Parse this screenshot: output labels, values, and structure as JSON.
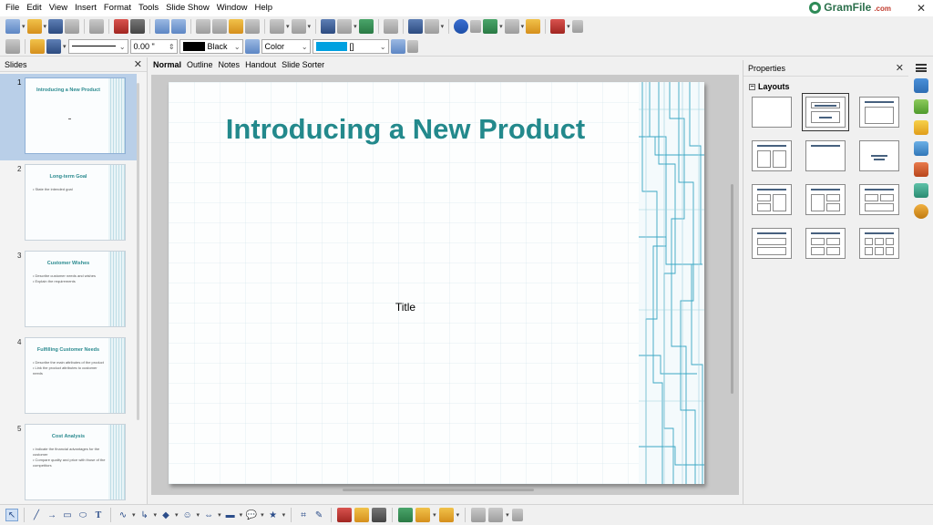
{
  "menu": [
    "File",
    "Edit",
    "View",
    "Insert",
    "Format",
    "Tools",
    "Slide Show",
    "Window",
    "Help"
  ],
  "brand": {
    "name": "GramFile",
    "domain": ".com"
  },
  "toolbar2": {
    "line_width": "0.00 \"",
    "line_color": "Black",
    "fill_type": "Color",
    "fill_color": "[]"
  },
  "slides_panel": {
    "title": "Slides",
    "slides": [
      {
        "num": "1",
        "title": "Introducing a New Product",
        "bullets": []
      },
      {
        "num": "2",
        "title": "Long-term Goal",
        "bullets": [
          "State the intended goal"
        ]
      },
      {
        "num": "3",
        "title": "Customer Wishes",
        "bullets": [
          "Describe customer needs and wishes",
          "Explain the requirements"
        ]
      },
      {
        "num": "4",
        "title": "Fulfilling Customer Needs",
        "bullets": [
          "Describe the main attributes of the product",
          "Link the product attributes to customer needs"
        ]
      },
      {
        "num": "5",
        "title": "Cost Analysis",
        "bullets": [
          "Indicate the financial advantages for the customer",
          "Compare quality and price with those of the competitors"
        ]
      }
    ]
  },
  "view_tabs": [
    "Normal",
    "Outline",
    "Notes",
    "Handout",
    "Slide Sorter"
  ],
  "slide": {
    "title": "Introducing a New Product",
    "subtitle": "Title"
  },
  "properties": {
    "title": "Properties",
    "section": "Layouts"
  },
  "colors": {
    "accent": "#23898c",
    "selection": "#b9cfe8"
  }
}
